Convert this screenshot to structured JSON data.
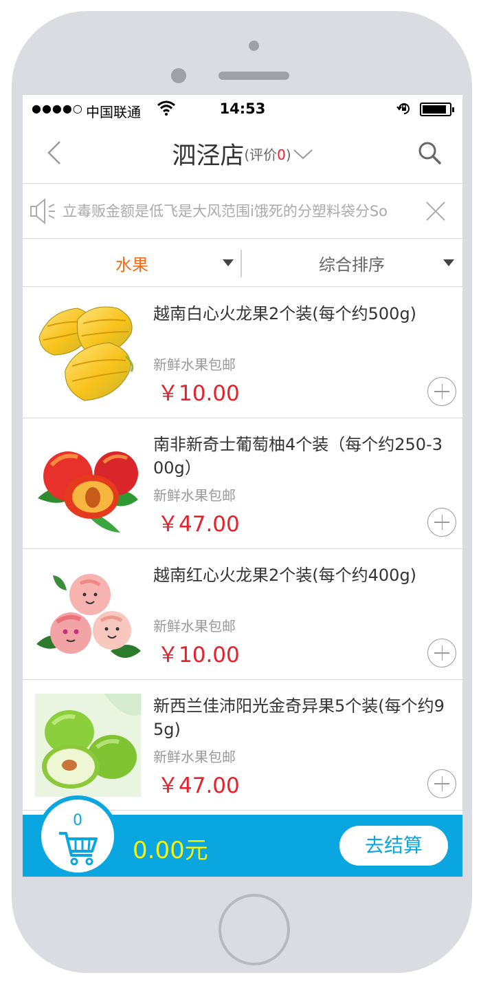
{
  "status_bar": {
    "signal": "●●●●○",
    "carrier": "中国联通",
    "time": "14:53"
  },
  "header": {
    "title": "泗泾店",
    "rating_prefix": "(评价",
    "rating_count": "0",
    "rating_suffix": ")"
  },
  "notice": {
    "text": "立毒贩金额是低飞是大风范围i饿死的分塑料袋分So"
  },
  "filter": {
    "category_label": "水果",
    "sort_label": "综合排序"
  },
  "products": [
    {
      "name": "越南白心火龙果2个装(每个约500g)",
      "subtitle": "新鲜水果包邮",
      "price": "￥10.00",
      "image": "starfruit"
    },
    {
      "name": "南非新奇士葡萄柚4个装（每个约250-300g）",
      "subtitle": "新鲜水果包邮",
      "price": "￥47.00",
      "image": "nectarines"
    },
    {
      "name": "越南红心火龙果2个装(每个约400g)",
      "subtitle": "新鲜水果包邮",
      "price": "￥10.00",
      "image": "cartoon-peaches"
    },
    {
      "name": "新西兰佳沛阳光金奇异果5个装(每个约95g)",
      "subtitle": "新鲜水果包邮",
      "price": "￥47.00",
      "image": "green-jujubes"
    }
  ],
  "cart": {
    "count": "0",
    "total": "0.00元",
    "checkout_label": "去结算"
  },
  "colors": {
    "accent_blue": "#0aa6df",
    "price_red": "#e8202a",
    "category_orange": "#f56a1a",
    "total_yellow": "#f6f20a"
  }
}
